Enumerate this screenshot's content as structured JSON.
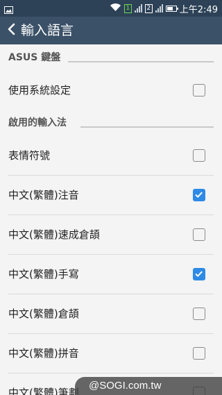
{
  "status_bar": {
    "sim1": "1",
    "sim2": "2",
    "time": "上午2:49",
    "icons": [
      "image-icon",
      "wifi-icon",
      "sim1-icon",
      "signal-icon",
      "sim2-icon",
      "signal-icon",
      "battery-icon"
    ]
  },
  "app_bar": {
    "title": "輸入語言",
    "back_icon": "chevron-left-icon"
  },
  "sections": [
    {
      "header": "ASUS 鍵盤",
      "items": [
        {
          "label": "使用系統設定",
          "checked": false
        }
      ]
    },
    {
      "header": "啟用的輸入法",
      "items": [
        {
          "label": "表情符號",
          "checked": false
        },
        {
          "label": "中文(繁體)注音",
          "checked": true
        },
        {
          "label": "中文(繁體)速成倉頡",
          "checked": false
        },
        {
          "label": "中文(繁體)手寫",
          "checked": true
        },
        {
          "label": "中文(繁體)倉頡",
          "checked": false
        },
        {
          "label": "中文(繁體)拼音",
          "checked": false
        },
        {
          "label": "中文(繁體)筆劃",
          "checked": false
        }
      ]
    }
  ],
  "watermark": "@SOGI.com.tw",
  "colors": {
    "status_bar": "#2d4257",
    "app_bar": "#3b5167",
    "background": "#f4f4f4",
    "checkbox_checked": "#2e8ae6"
  }
}
